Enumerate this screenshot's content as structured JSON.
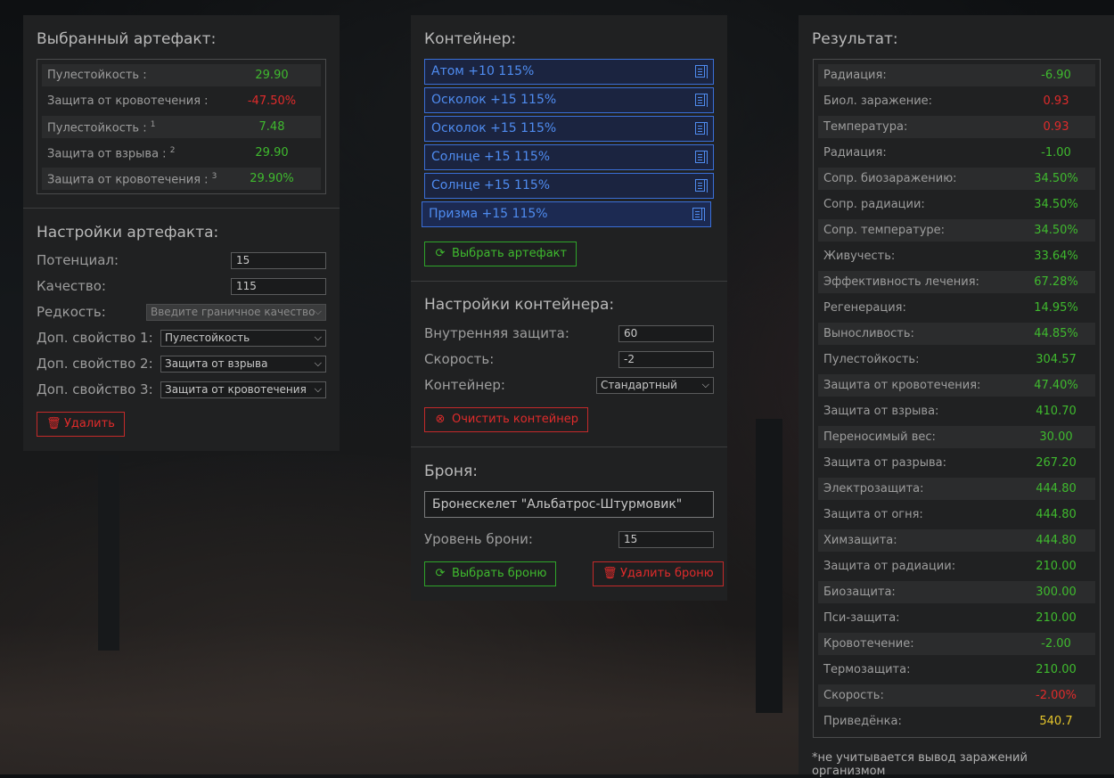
{
  "colors": {
    "positive": "#3fba2e",
    "negative": "#e02b2b",
    "highlight": "#e6c62b",
    "accent_blue": "#4f8cf0"
  },
  "selected_artifact": {
    "title": "Выбранный артефакт:",
    "stats": [
      {
        "label": "Пулестойкость :",
        "sup": "",
        "value": "29.90",
        "tone": "green"
      },
      {
        "label": "Защита от кровотечения :",
        "sup": "",
        "value": "-47.50%",
        "tone": "red"
      },
      {
        "label": "Пулестойкость :",
        "sup": "1",
        "value": "7.48",
        "tone": "green"
      },
      {
        "label": "Защита от взрыва :",
        "sup": "2",
        "value": "29.90",
        "tone": "green"
      },
      {
        "label": "Защита от кровотечения :",
        "sup": "3",
        "value": "29.90%",
        "tone": "green"
      }
    ]
  },
  "artifact_settings": {
    "title": "Настройки артефакта:",
    "potential_label": "Потенциал:",
    "potential_value": "15",
    "quality_label": "Качество:",
    "quality_value": "115",
    "rarity_label": "Редкость:",
    "rarity_value": "Введите граничное качество",
    "extra1_label": "Доп. свойство 1:",
    "extra1_value": "Пулестойкость",
    "extra2_label": "Доп. свойство 2:",
    "extra2_value": "Защита от взрыва",
    "extra3_label": "Доп. свойство 3:",
    "extra3_value": "Защита от кровотечения",
    "delete_label": "Удалить"
  },
  "container": {
    "title": "Контейнер:",
    "items": [
      "Атом +10 115%",
      "Осколок +15 115%",
      "Осколок +15 115%",
      "Солнце +15 115%",
      "Солнце +15 115%",
      "Призма +15 115%"
    ],
    "select_artifact_label": "Выбрать артефакт"
  },
  "container_settings": {
    "title": "Настройки контейнера:",
    "inner_protection_label": "Внутренняя защита:",
    "inner_protection_value": "60",
    "speed_label": "Скорость:",
    "speed_value": "-2",
    "container_label": "Контейнер:",
    "container_value": "Стандартный",
    "clear_label": "Очистить контейнер"
  },
  "armor": {
    "title": "Броня:",
    "name": "Бронескелет \"Альбатрос-Штурмовик\"",
    "level_label": "Уровень брони:",
    "level_value": "15",
    "select_label": "Выбрать броню",
    "delete_label": "Удалить броню"
  },
  "result": {
    "title": "Результат:",
    "stats": [
      {
        "label": "Радиация:",
        "value": "-6.90",
        "tone": "green"
      },
      {
        "label": "Биол. заражение:",
        "value": "0.93",
        "tone": "red"
      },
      {
        "label": "Температура:",
        "value": "0.93",
        "tone": "red"
      },
      {
        "label": "Радиация:",
        "value": "-1.00",
        "tone": "green"
      },
      {
        "label": "Сопр. биозаражению:",
        "value": "34.50%",
        "tone": "green"
      },
      {
        "label": "Сопр. радиации:",
        "value": "34.50%",
        "tone": "green"
      },
      {
        "label": "Сопр. температуре:",
        "value": "34.50%",
        "tone": "green"
      },
      {
        "label": "Живучесть:",
        "value": "33.64%",
        "tone": "green"
      },
      {
        "label": "Эффективность лечения:",
        "value": "67.28%",
        "tone": "green"
      },
      {
        "label": "Регенерация:",
        "value": "14.95%",
        "tone": "green"
      },
      {
        "label": "Выносливость:",
        "value": "44.85%",
        "tone": "green"
      },
      {
        "label": "Пулестойкость:",
        "value": "304.57",
        "tone": "green"
      },
      {
        "label": "Защита от кровотечения:",
        "value": "47.40%",
        "tone": "green"
      },
      {
        "label": "Защита от взрыва:",
        "value": "410.70",
        "tone": "green"
      },
      {
        "label": "Переносимый вес:",
        "value": "30.00",
        "tone": "green"
      },
      {
        "label": "Защита от разрыва:",
        "value": "267.20",
        "tone": "green"
      },
      {
        "label": "Электрозащита:",
        "value": "444.80",
        "tone": "green"
      },
      {
        "label": "Защита от огня:",
        "value": "444.80",
        "tone": "green"
      },
      {
        "label": "Химзащита:",
        "value": "444.80",
        "tone": "green"
      },
      {
        "label": "Защита от радиации:",
        "value": "210.00",
        "tone": "green"
      },
      {
        "label": "Биозащита:",
        "value": "300.00",
        "tone": "green"
      },
      {
        "label": "Пси-защита:",
        "value": "210.00",
        "tone": "green"
      },
      {
        "label": "Кровотечение:",
        "value": "-2.00",
        "tone": "green"
      },
      {
        "label": "Термозащита:",
        "value": "210.00",
        "tone": "green"
      },
      {
        "label": "Скорость:",
        "value": "-2.00%",
        "tone": "red"
      },
      {
        "label": "Приведёнка:",
        "value": "540.7",
        "tone": "yellow"
      }
    ],
    "footnote": "*не учитывается вывод заражений организмом"
  }
}
